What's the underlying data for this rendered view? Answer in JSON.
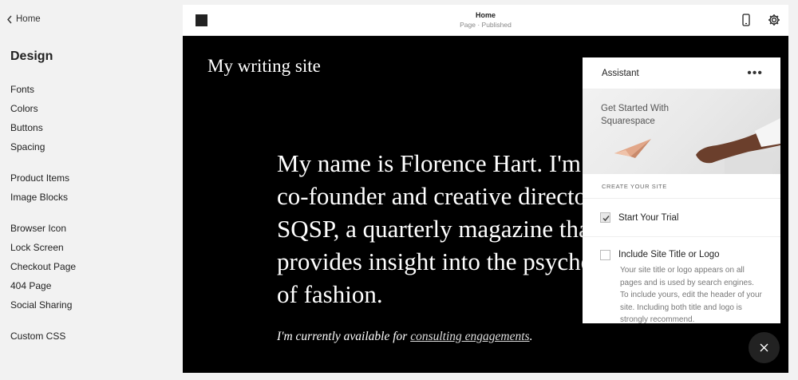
{
  "sidebar": {
    "back_label": "Home",
    "title": "Design",
    "groups": [
      [
        "Fonts",
        "Colors",
        "Buttons",
        "Spacing"
      ],
      [
        "Product Items",
        "Image Blocks"
      ],
      [
        "Browser Icon",
        "Lock Screen",
        "Checkout Page",
        "404 Page",
        "Social Sharing"
      ],
      [
        "Custom CSS"
      ]
    ]
  },
  "topbar": {
    "title": "Home",
    "subtitle": "Page · Published"
  },
  "canvas": {
    "site_title": "My writing site",
    "hero_lines": [
      "My name is Florence Hart. I'm",
      "co-founder and creative director of",
      "SQSP, a quarterly magazine that",
      "provides insight into the psychology",
      "of fashion."
    ],
    "tagline_prefix": "I'm currently available for ",
    "tagline_link": "consulting engagements",
    "tagline_suffix": "."
  },
  "assistant": {
    "title": "Assistant",
    "more_label": "•••",
    "banner_text": "Get Started With Squarespace",
    "section_label": "CREATE YOUR SITE",
    "tasks": [
      {
        "label": "Start Your Trial",
        "done": true
      },
      {
        "label": "Include Site Title or Logo",
        "done": false,
        "description": "Your site title or logo appears on all pages and is used by search engines. To include yours, edit the header of your site. Including both title and logo is strongly recommend."
      }
    ]
  }
}
